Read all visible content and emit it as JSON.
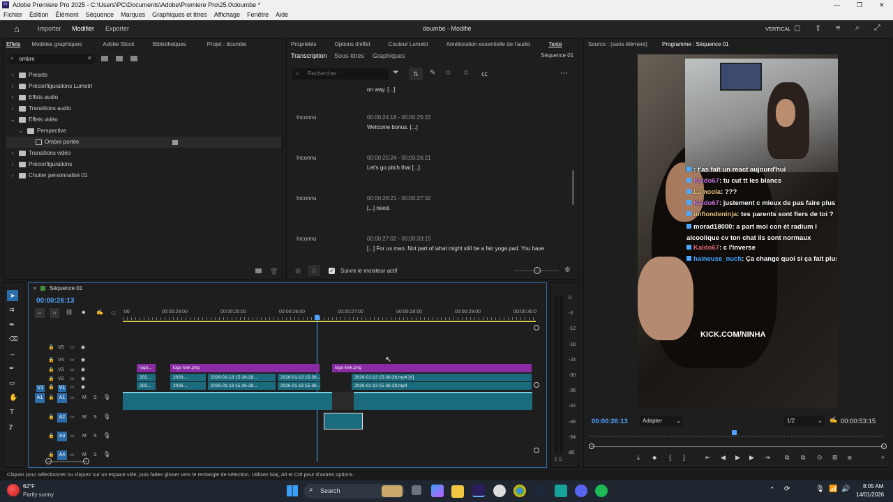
{
  "window": {
    "title": "Adobe Premiere Pro 2025 - C:\\Users\\PC\\Documents\\Adobe\\Premiere Pro\\25.0\\doumbe *"
  },
  "menu": [
    "Fichier",
    "Édition",
    "Élément",
    "Séquence",
    "Marques",
    "Graphiques et titres",
    "Affichage",
    "Fenêtre",
    "Aide"
  ],
  "appbar": {
    "nav": [
      "Importer",
      "Modifier",
      "Exporter"
    ],
    "project_title": "doumbe - Modifié",
    "layout_label": "VERTICAL"
  },
  "effects_panel": {
    "tabs": [
      "Effets",
      "Modèles graphiques",
      "Adobe Stock",
      "Bibliothèques",
      "Projet : doumbe"
    ],
    "search_value": "ombre",
    "tree": [
      {
        "label": "Presets",
        "level": 0,
        "expanded": false
      },
      {
        "label": "Préconfigurations Lumetri",
        "level": 0,
        "expanded": false
      },
      {
        "label": "Effets audio",
        "level": 0,
        "expanded": false
      },
      {
        "label": "Transitions audio",
        "level": 0,
        "expanded": false
      },
      {
        "label": "Effets vidéo",
        "level": 0,
        "expanded": true
      },
      {
        "label": "Perspective",
        "level": 1,
        "expanded": true
      },
      {
        "label": "Ombre portée",
        "level": 2,
        "expanded": false,
        "selected": true
      },
      {
        "label": "Transitions vidéo",
        "level": 0,
        "expanded": false
      },
      {
        "label": "Préconfigurations",
        "level": 0,
        "expanded": false
      },
      {
        "label": "Chutier personnalisé 01",
        "level": 0,
        "expanded": false
      }
    ]
  },
  "text_panel": {
    "top_tabs": [
      "Propriétés",
      "Options d'effet",
      "Couleur Lumetri",
      "Amélioration essentielle de l'audio",
      "Texte"
    ],
    "sub_tabs": [
      "Transcription",
      "Sous-titres",
      "Graphiques"
    ],
    "sequence_label": "Séquence 01",
    "search_placeholder": "Rechercher",
    "top_fragment": "on way. [...]",
    "entries": [
      {
        "speaker": "Inconnu",
        "time": "00:00:24:18 - 00:00:25:22",
        "text": "Welcome bonus. [...]"
      },
      {
        "speaker": "Inconnu",
        "time": "00:00:25:24 - 00:00:26:21",
        "text": "Let's go pitch that [...]"
      },
      {
        "speaker": "Inconnu",
        "time": "00:00:26:21 - 00:00:27:02",
        "text": "[...] need."
      },
      {
        "speaker": "Inconnu",
        "time": "00:00:27:02 - 00:00:33:15",
        "text": "[...] For us man. Not part of what might still be a fair yoga pad. You have"
      }
    ],
    "follow_label": "Suivre le moniteur actif"
  },
  "timeline": {
    "sequence_name": "Séquence 01",
    "timecode": "00:00:26:13",
    "ruler": [
      ":00",
      "00:00:24:00",
      "00:00:25:00",
      "00:00:26:00",
      "00:00:27:00",
      "00:00:28:00",
      "00:00:29:00",
      "00:00:30:0"
    ],
    "video_tracks": [
      "V5",
      "V4",
      "V3",
      "V2",
      "V1"
    ],
    "audio_tracks": [
      "A1",
      "A2",
      "A3",
      "A4"
    ],
    "clips": {
      "v3": [
        "logo...",
        "logo kivk.png",
        "logo kivk.png"
      ],
      "v2": [
        "202...",
        "2026-...",
        "2026-01-13 15-36-28...",
        "2026-01-13 15-36-...",
        "2026-01-13 15-36-28.mp4 [V]"
      ],
      "v1": [
        "202...",
        "2026-...",
        "2026-01-13 15-36-28...",
        "2026-01-13 15-36-...",
        "2026-01-13 15-36-28.mp4"
      ]
    },
    "meter_scale": [
      "0",
      "-6",
      "-12",
      "-18",
      "-24",
      "-30",
      "-36",
      "-42",
      "-48",
      "-54",
      "dB"
    ],
    "meter_footer": "S S"
  },
  "program_monitor": {
    "source_tab": "Source : (sans élément)",
    "program_tab": "Programme : Séquence 01",
    "timecode": "00:00:26:13",
    "fit": "Adapter",
    "resolution": "1/2",
    "duration": "00:00:53:15",
    "overlay_text": "KICK.COM/NINHA",
    "chat": [
      {
        "user": "",
        "msg": "t'as fait un react aujourd'hui"
      },
      {
        "user": "Kaldo67",
        "msg": "tu cut tt les blancs"
      },
      {
        "user": "Lamoola",
        "msg": "???"
      },
      {
        "user": "Kaldo67",
        "msg": "justement c mieux de pas faire plus"
      },
      {
        "user": "unfiondeninja",
        "msg": "tes parents sont fiers de toi ?"
      },
      {
        "user": "morad18000",
        "msg": "a part moi con ét radium l alcoolique cv ton chat ils sont normaux"
      },
      {
        "user": "Kaldo67",
        "msg": "c l'inverse"
      },
      {
        "user": "haineuse_nuch",
        "msg": "Ça change quoi si ça fait plus d'une minute"
      }
    ],
    "chat_user_colors": [
      "#4aa8ff",
      "#c678dd",
      "#e5c07b",
      "#c678dd",
      "#e5c07b",
      "#ffffff",
      "#e06c75",
      "#4aa8ff"
    ]
  },
  "status_bar": {
    "message": "Cliquez pour sélectionner ou cliquez sur un espace vide, puis faites glisser vers le rectangle de sélection. Utilisez Maj, Alt et Ctrl pour d'autres options."
  },
  "taskbar": {
    "weather_temp": "62°F",
    "weather_desc": "Partly sunny",
    "search_label": "Search",
    "time": "8:05 AM",
    "date": "14/01/2026"
  }
}
